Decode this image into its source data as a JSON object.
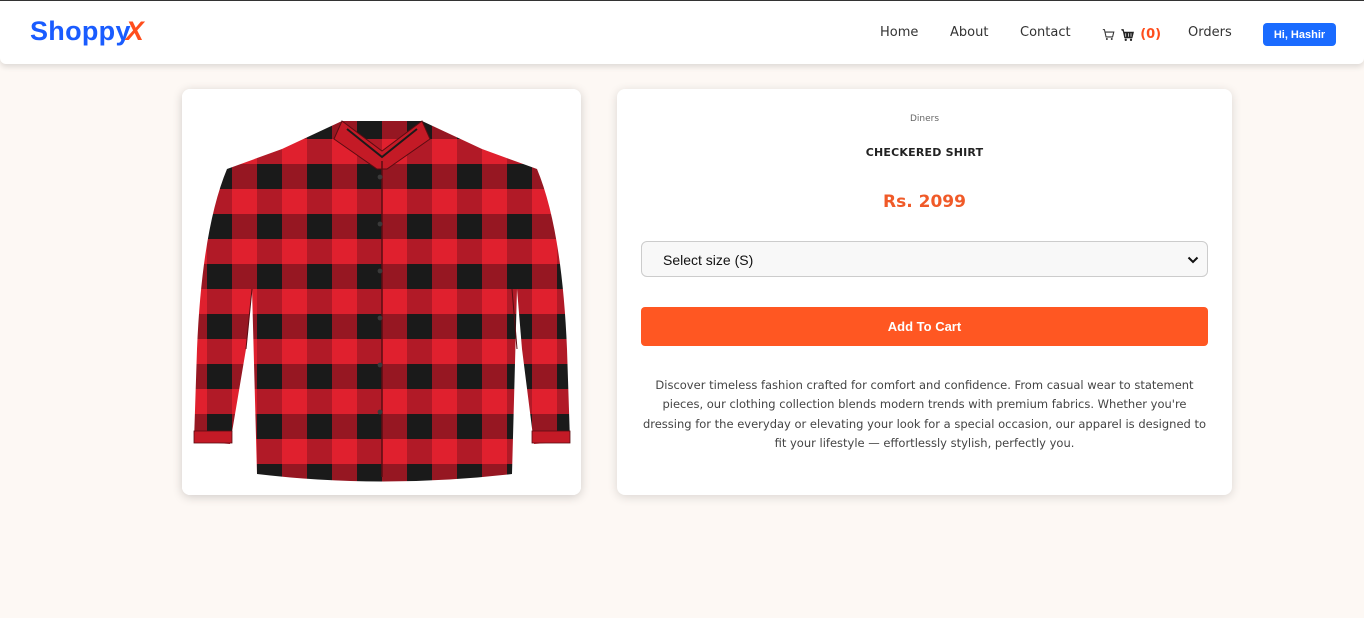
{
  "navbar": {
    "logo_main": "Shoppy",
    "logo_accent": "X",
    "links": [
      "Home",
      "About",
      "Contact",
      "Orders"
    ],
    "cart_count": "(0)",
    "user_button": "Hi, Hashir"
  },
  "product": {
    "brand": "Diners",
    "title": "CHECKERED SHIRT",
    "price": "Rs. 2099",
    "size_select": "Select size (S)",
    "add_to_cart": "Add To Cart",
    "description": "Discover timeless fashion crafted for comfort and confidence. From casual wear to statement pieces, our clothing collection blends modern trends with premium fabrics. Whether you're dressing for the everyday or elevating your look for a special occasion, our apparel is designed to fit your lifestyle — effortlessly stylish, perfectly you."
  },
  "colors": {
    "brand_blue": "#1a5cff",
    "accent_orange": "#ff5722",
    "price_orange": "#f05a28",
    "shirt_red": "#e0202e",
    "shirt_black": "#1a1a1a"
  }
}
